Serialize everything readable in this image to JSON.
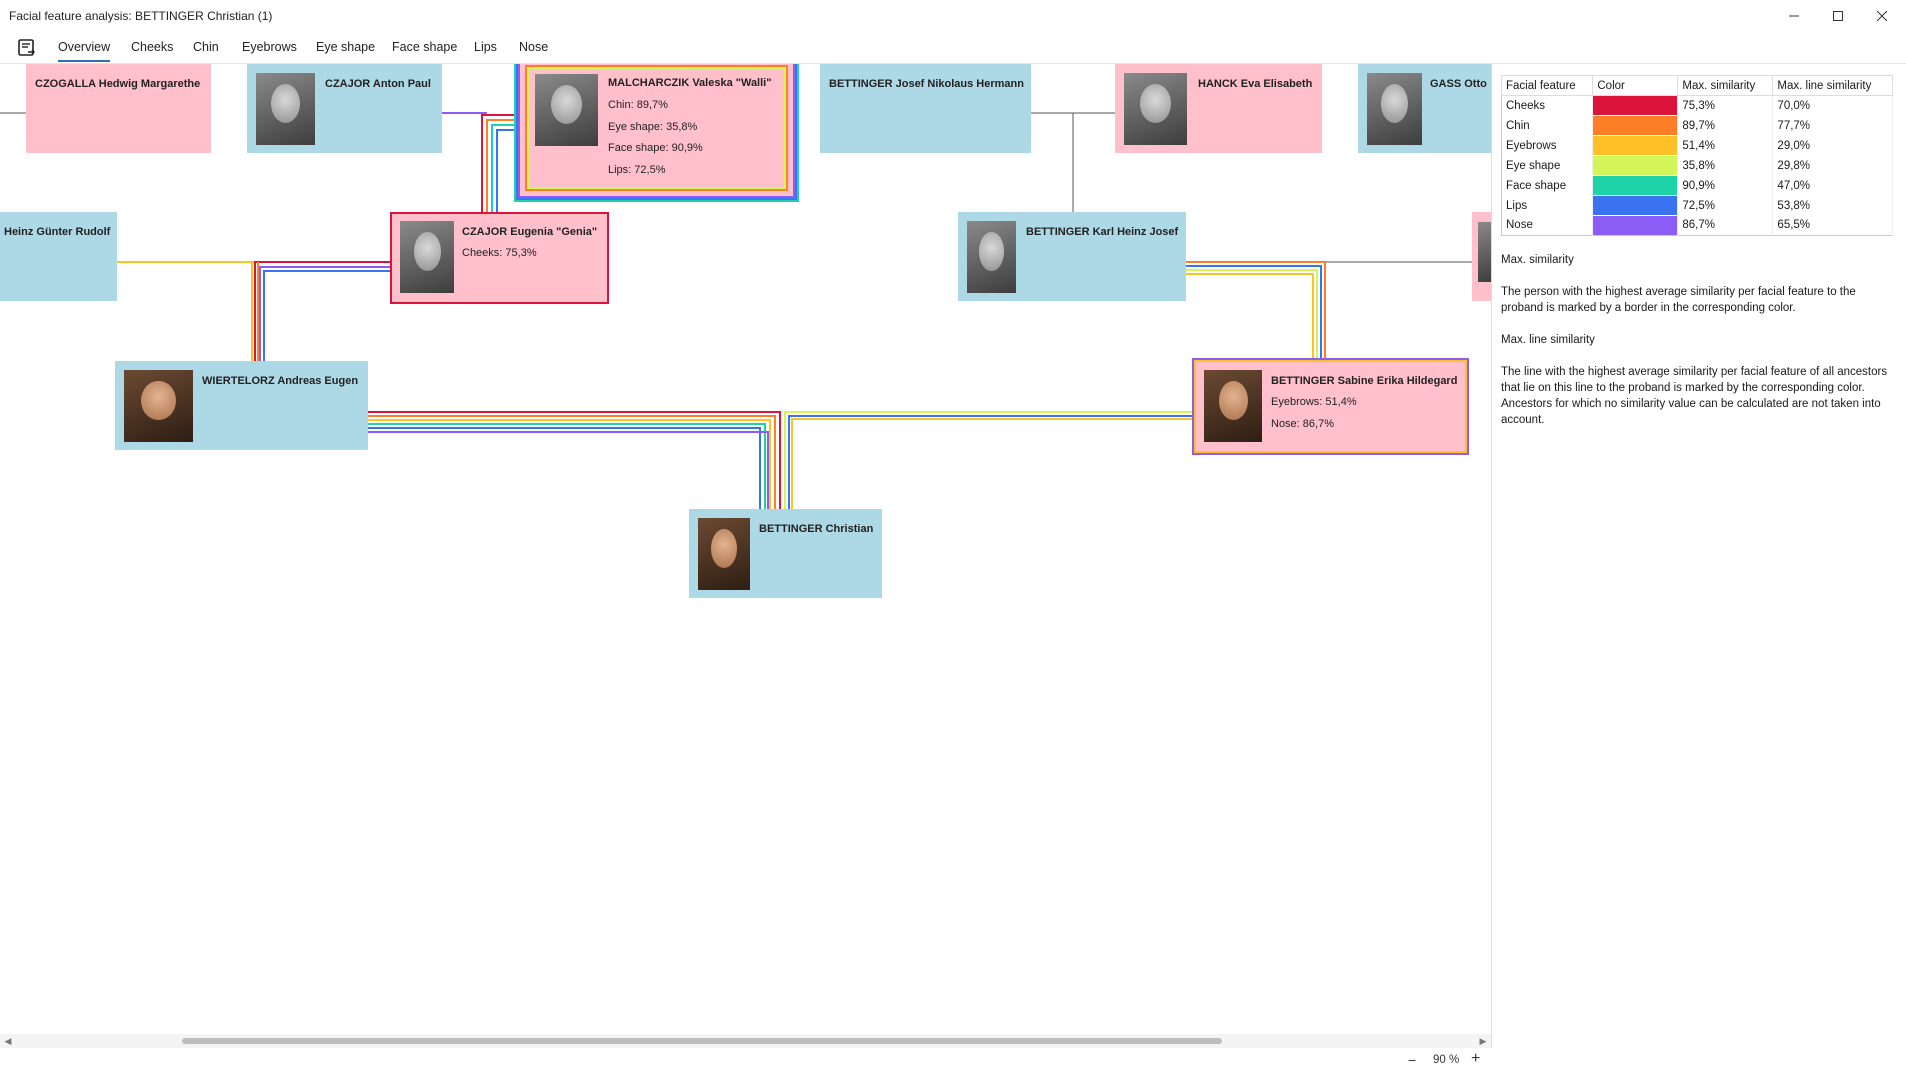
{
  "window": {
    "title": "Facial feature analysis: BETTINGER Christian (1)"
  },
  "tabs": [
    "Overview",
    "Cheeks",
    "Chin",
    "Eyebrows",
    "Eye shape",
    "Face shape",
    "Lips",
    "Nose"
  ],
  "persons": {
    "czogalla": {
      "name": "CZOGALLA Hedwig Margarethe"
    },
    "czajor_anton": {
      "name": "CZAJOR Anton Paul"
    },
    "malcharczik": {
      "name": "MALCHARCZIK Valeska \"Walli\"",
      "sims": [
        "Chin: 89,7%",
        "Eye shape: 35,8%",
        "Face shape: 90,9%",
        "Lips: 72,5%"
      ]
    },
    "bettinger_josef": {
      "name": "BETTINGER Josef Nikolaus Hermann"
    },
    "hanck": {
      "name": "HANCK Eva Elisabeth"
    },
    "gass": {
      "name": "GASS Otto"
    },
    "heinz": {
      "name": "Heinz Günter Rudolf"
    },
    "czajor_eugenia": {
      "name": "CZAJOR Eugenia \"Genia\"",
      "sims": [
        "Cheeks: 75,3%"
      ]
    },
    "bettinger_karl": {
      "name": "BETTINGER Karl Heinz Josef"
    },
    "wiertelorz": {
      "name": "WIERTELORZ Andreas Eugen"
    },
    "bettinger_sabine": {
      "name": "BETTINGER Sabine Erika Hildegard",
      "sims": [
        "Eyebrows: 51,4%",
        "Nose: 86,7%"
      ]
    },
    "bettinger_christian": {
      "name": "BETTINGER Christian"
    }
  },
  "legend": {
    "headers": [
      "Facial feature",
      "Color",
      "Max. similarity",
      "Max. line similarity"
    ],
    "rows": [
      {
        "feature": "Cheeks",
        "color": "#dc143c",
        "max": "75,3%",
        "line": "70,0%"
      },
      {
        "feature": "Chin",
        "color": "#ff7f27",
        "max": "89,7%",
        "line": "77,7%"
      },
      {
        "feature": "Eyebrows",
        "color": "#ffc125",
        "max": "51,4%",
        "line": "29,0%"
      },
      {
        "feature": "Eye shape",
        "color": "#d4f55a",
        "max": "35,8%",
        "line": "29,8%"
      },
      {
        "feature": "Face shape",
        "color": "#1dd3a7",
        "max": "90,9%",
        "line": "47,0%"
      },
      {
        "feature": "Lips",
        "color": "#3a73f0",
        "max": "72,5%",
        "line": "53,8%"
      },
      {
        "feature": "Nose",
        "color": "#8b5cf6",
        "max": "86,7%",
        "line": "65,5%"
      }
    ]
  },
  "panel": {
    "h1": "Max. similarity",
    "p1": "The person with the highest average similarity per facial feature to the proband is marked by a border in the corresponding color.",
    "h2": "Max. line similarity",
    "p2": "The line with the highest average similarity per facial feature of all ancestors that lie on this line to the proband is marked by the corresponding color. Ancestors for which no similarity value can be calculated are not taken into account."
  },
  "zoom": {
    "minus": "−",
    "value": "90 %",
    "plus": "+"
  },
  "colors": {
    "male": "#add8e6",
    "female": "#ffc0cb",
    "tab_underline": "#2f6db5"
  }
}
